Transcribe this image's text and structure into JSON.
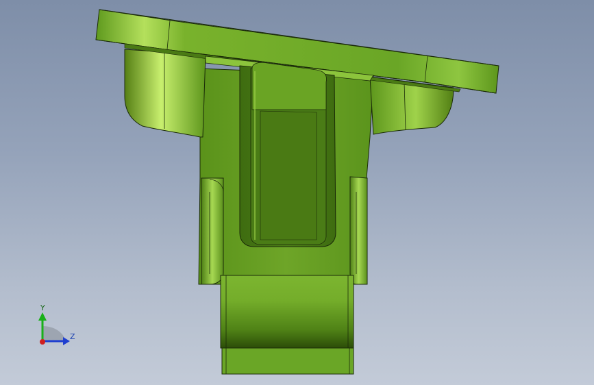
{
  "viewport": {
    "background_top": "#7e8ea8",
    "background_bottom": "#c3cbd8"
  },
  "model": {
    "color_base": "#6fa82a",
    "color_light": "#9fd24a",
    "color_dark": "#3f6e12",
    "edge_color": "#1a2a08"
  },
  "triad": {
    "y_label": "Y",
    "z_label": "Z",
    "y_color": "#19b019",
    "z_color": "#1f3fd0",
    "x_color": "#d01f1f",
    "icons": [
      "y-axis-arrow-icon",
      "z-axis-arrow-icon",
      "x-axis-dot-icon",
      "view-plane-icon"
    ]
  }
}
